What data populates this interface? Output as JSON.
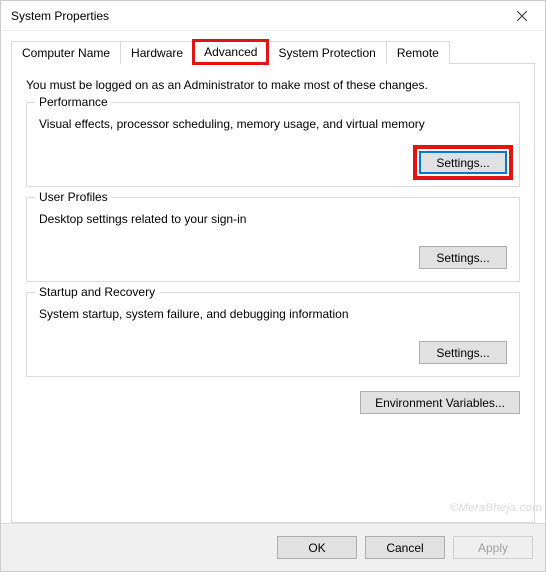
{
  "window": {
    "title": "System Properties"
  },
  "tabs": {
    "computer_name": "Computer Name",
    "hardware": "Hardware",
    "advanced": "Advanced",
    "system_protection": "System Protection",
    "remote": "Remote"
  },
  "panel": {
    "info_text": "You must be logged on as an Administrator to make most of these changes."
  },
  "groups": {
    "performance": {
      "legend": "Performance",
      "desc": "Visual effects, processor scheduling, memory usage, and virtual memory",
      "settings_label": "Settings..."
    },
    "user_profiles": {
      "legend": "User Profiles",
      "desc": "Desktop settings related to your sign-in",
      "settings_label": "Settings..."
    },
    "startup_recovery": {
      "legend": "Startup and Recovery",
      "desc": "System startup, system failure, and debugging information",
      "settings_label": "Settings..."
    }
  },
  "env_button": "Environment Variables...",
  "footer": {
    "ok": "OK",
    "cancel": "Cancel",
    "apply": "Apply"
  },
  "watermark": "©MeraBheja.com"
}
